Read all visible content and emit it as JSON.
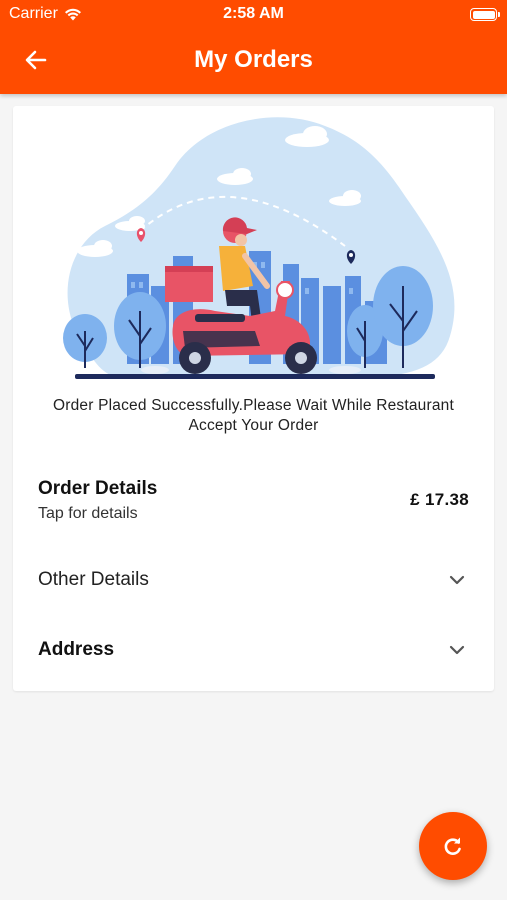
{
  "status_bar": {
    "carrier": "Carrier",
    "time": "2:58 AM"
  },
  "header": {
    "title": "My Orders",
    "back_icon": "arrow-left-icon",
    "background_color": "#ff4c00"
  },
  "order": {
    "message": "Order Placed Successfully.Please Wait While Restaurant Accept Your Order",
    "details_title": "Order Details",
    "details_subtitle": "Tap for details",
    "total": "£ 17.38",
    "other_details_label": "Other Details",
    "address_label": "Address",
    "chevron_icon": "chevron-down-icon"
  },
  "fab": {
    "icon": "refresh-icon",
    "color": "#ff4c00"
  }
}
